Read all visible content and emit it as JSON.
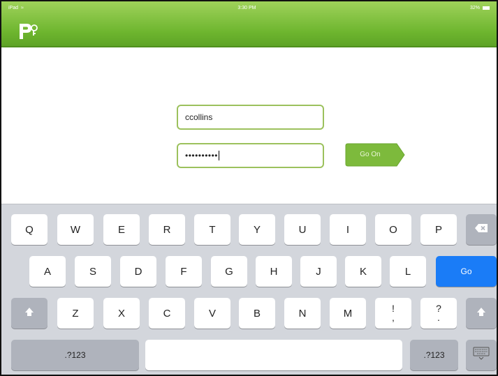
{
  "status_bar": {
    "carrier": "iPad",
    "time": "3:30 PM",
    "battery": "32%"
  },
  "app": {
    "logo_text": "P"
  },
  "login": {
    "username": "ccollins",
    "password_mask": "••••••••••",
    "go_button": "Go On"
  },
  "keyboard": {
    "row1": [
      "Q",
      "W",
      "E",
      "R",
      "T",
      "Y",
      "U",
      "I",
      "O",
      "P"
    ],
    "row2": [
      "A",
      "S",
      "D",
      "F",
      "G",
      "H",
      "J",
      "K",
      "L"
    ],
    "row3": [
      "Z",
      "X",
      "C",
      "V",
      "B",
      "N",
      "M"
    ],
    "exclaim_top": "!",
    "exclaim_bottom": ",",
    "question_top": "?",
    "question_bottom": ".",
    "go_label": "Go",
    "numbers_label": ".?123",
    "icons": {
      "backspace": "backspace-icon",
      "shift": "shift-icon",
      "hide": "keyboard-hide-icon"
    },
    "colors": {
      "go": "#1a7cf7",
      "dark_key": "#afb3bc",
      "accent": "#6db52e"
    }
  }
}
